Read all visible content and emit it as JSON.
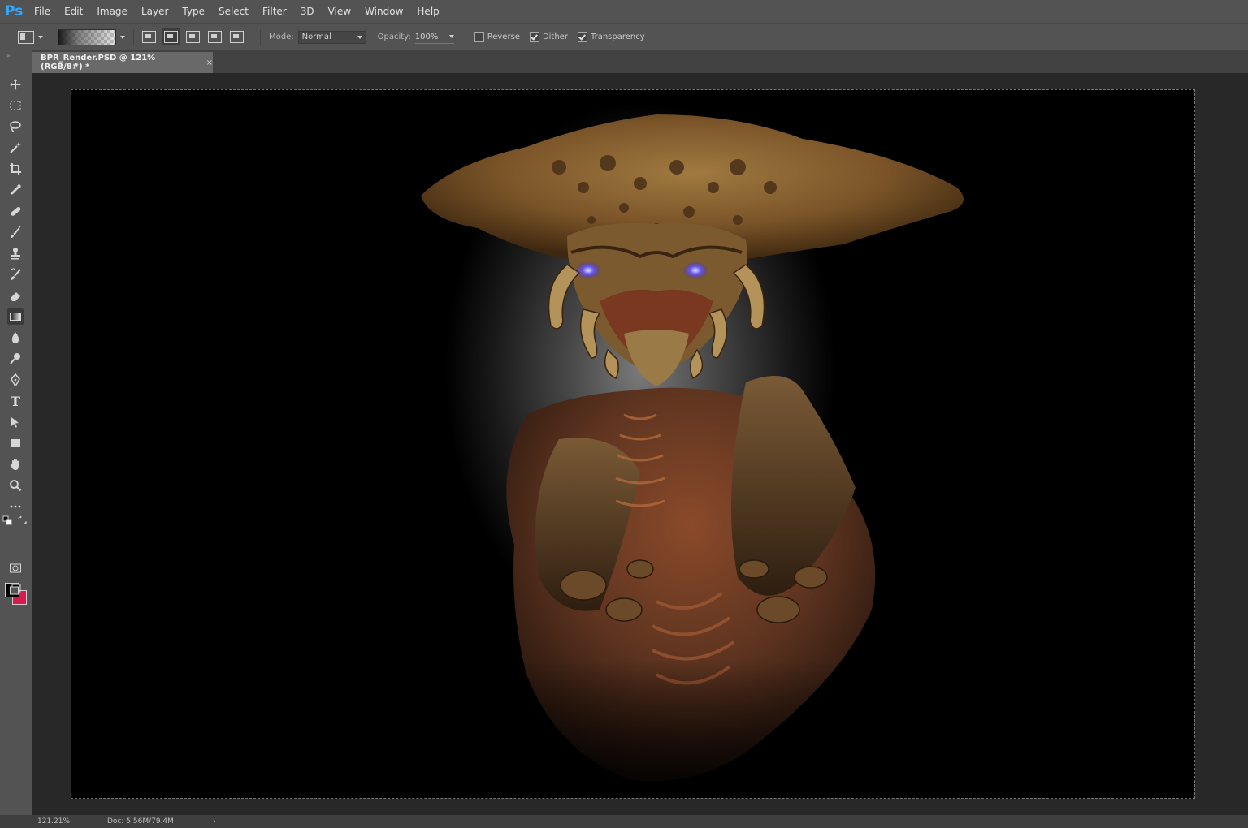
{
  "app": {
    "logo": "Ps"
  },
  "menu": [
    "File",
    "Edit",
    "Image",
    "Layer",
    "Type",
    "Select",
    "Filter",
    "3D",
    "View",
    "Window",
    "Help"
  ],
  "options": {
    "mode_label": "Mode:",
    "mode_value": "Normal",
    "opacity_label": "Opacity:",
    "opacity_value": "100%",
    "reverse_label": "Reverse",
    "reverse_checked": false,
    "dither_label": "Dither",
    "dither_checked": true,
    "transparency_label": "Transparency",
    "transparency_checked": true
  },
  "tools": [
    "move-icon",
    "marquee-icon",
    "lasso-icon",
    "magic-wand-icon",
    "crop-icon",
    "eyedropper-icon",
    "healing-brush-icon",
    "brush-icon",
    "clone-stamp-icon",
    "history-brush-icon",
    "eraser-icon",
    "gradient-icon",
    "blur-icon",
    "dodge-icon",
    "pen-icon",
    "type-icon",
    "path-selection-icon",
    "rectangle-icon",
    "hand-icon",
    "zoom-icon",
    "more-tools-icon"
  ],
  "active_tool": "gradient-icon",
  "colors": {
    "foreground": "#000000",
    "background": "#d81a4f",
    "accent": "#31a8ff"
  },
  "document": {
    "tab_title": "BPR_Render.PSD @ 121% (RGB/8#) *",
    "close": "×"
  },
  "status": {
    "zoom": "121.21%",
    "doc_info": "Doc: 5.56M/79.4M",
    "arrow": "›"
  }
}
